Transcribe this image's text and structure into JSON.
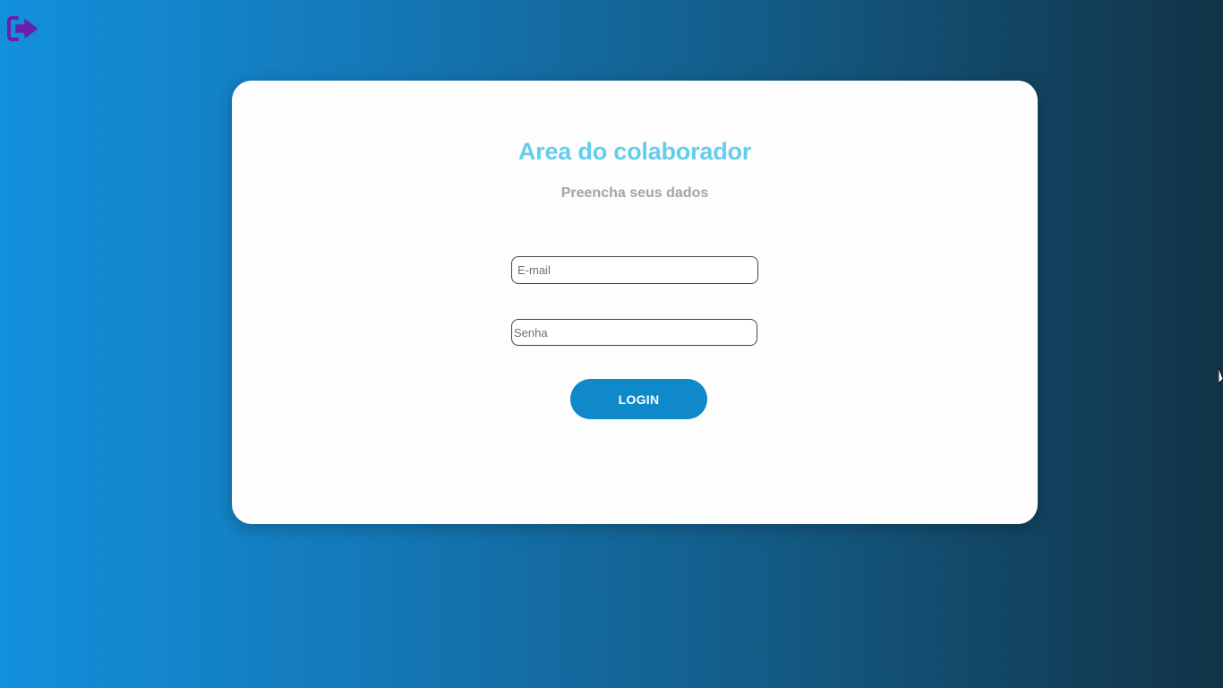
{
  "header": {
    "logout_icon": "logout-icon",
    "icon_color": "#6a1fa8"
  },
  "login_card": {
    "title": "Area do colaborador",
    "subtitle": "Preencha seus dados",
    "email": {
      "value": "",
      "placeholder": "E-mail"
    },
    "password": {
      "value": "",
      "placeholder": "Senha"
    },
    "login_button_label": "LOGIN"
  },
  "colors": {
    "title": "#63cdee",
    "subtitle": "#a4a4a4",
    "button": "#0f89c9",
    "background_start": "#1290dc",
    "background_end": "#123346"
  }
}
